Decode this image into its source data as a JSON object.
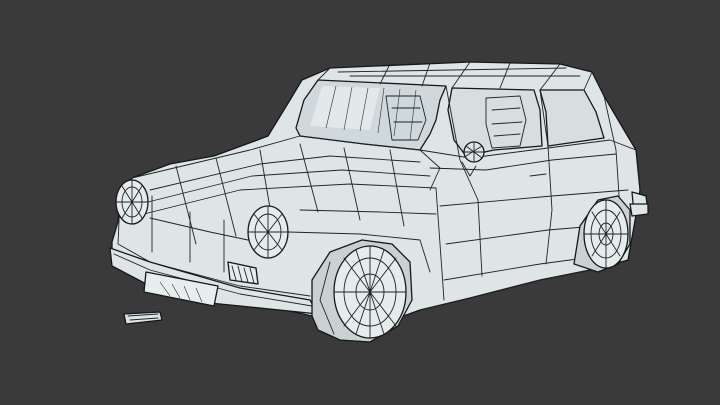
{
  "scene": {
    "background_color": "#3a3a3a",
    "model_fill": "#dfe5e6",
    "model_shade": "#c9d1d3",
    "glass_fill": "#cfd8da",
    "tire_fill": "#e6ebec",
    "wire_color": "#1f2326"
  },
  "icons": {
    "model": "car-wireframe-icon"
  }
}
